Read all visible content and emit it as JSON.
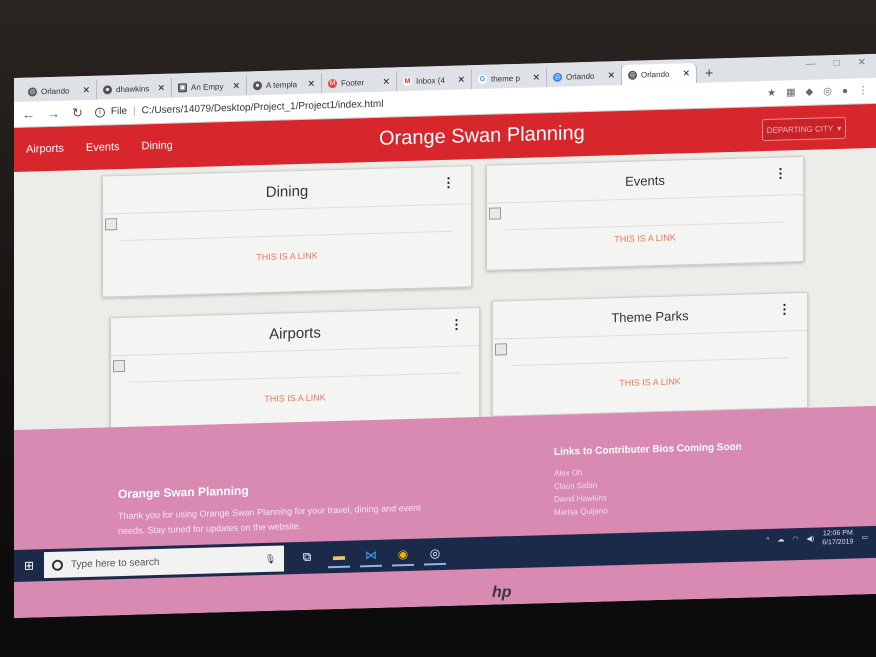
{
  "browser": {
    "tabs": [
      {
        "icon": "globe-icon",
        "label": "Orlando"
      },
      {
        "icon": "github-icon",
        "label": "dhawkins"
      },
      {
        "icon": "doc-icon",
        "label": "An Empy"
      },
      {
        "icon": "github-icon",
        "label": "A templa"
      },
      {
        "icon": "m-icon",
        "label": "Footer"
      },
      {
        "icon": "gmail-icon",
        "label": "Inbox (4"
      },
      {
        "icon": "google-icon",
        "label": "theme p"
      },
      {
        "icon": "globe-icon",
        "label": "Orlando"
      },
      {
        "icon": "globe-icon",
        "label": "Orlando"
      }
    ],
    "file_label": "File",
    "url": "C:/Users/14079/Desktop/Project_1/Project1/index.html"
  },
  "navbar": {
    "links": [
      "Airports",
      "Events",
      "Dining"
    ],
    "brand": "Orange Swan Planning",
    "dropdown_label": "DEPARTING CITY"
  },
  "cards": [
    {
      "title": "Dining",
      "link": "THIS IS A LINK"
    },
    {
      "title": "Events",
      "link": "THIS IS A LINK"
    },
    {
      "title": "Airports",
      "link": "THIS IS A LINK"
    },
    {
      "title": "Theme Parks",
      "link": "THIS IS A LINK"
    }
  ],
  "footer": {
    "title": "Orange Swan Planning",
    "text": "Thank you for using Orange Swan Planning for your travel, dining and event needs. Stay tuned for updates on the website.",
    "links_title": "Links to Contributer Bios Coming Soon",
    "contributors": [
      "Alex Oh",
      "Claus Sabin",
      "David Hawkins",
      "Marisa Quijano"
    ]
  },
  "taskbar": {
    "search_placeholder": "Type here to search",
    "time": "12:06 PM",
    "date": "6/17/2019"
  },
  "colors": {
    "navbar": "#d8262d",
    "footer": "#d98ab2",
    "link": "#e07c62"
  }
}
